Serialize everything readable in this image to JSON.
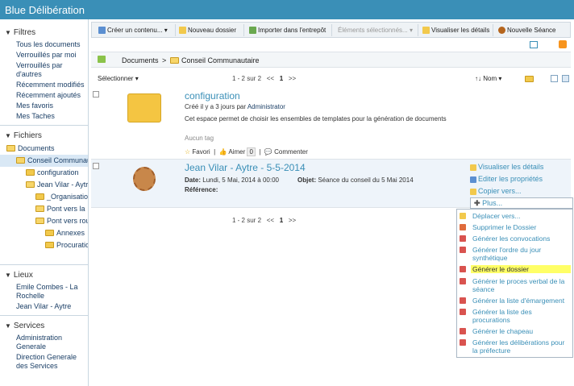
{
  "app": {
    "title": "Blue Délibération"
  },
  "sidebar": {
    "filters_title": "Filtres",
    "filters": [
      "Tous les documents",
      "Verrouillés par moi",
      "Verrouillés par d'autres",
      "Récemment modifiés",
      "Récemment ajoutés",
      "Mes favoris",
      "Mes Taches"
    ],
    "files_title": "Fichiers",
    "tree": [
      "Documents",
      "Conseil Communautaire",
      "configuration",
      "Jean Vilar - Aytre",
      "_Organisation",
      "Pont vers la",
      "Pont vers rou",
      "Annexes",
      "Procurations"
    ],
    "places_title": "Lieux",
    "places": [
      "Emile Combes - La Rochelle",
      "Jean Vilar - Aytre"
    ],
    "services_title": "Services",
    "services": [
      "Administration Generale",
      "Direction Generale des Services"
    ]
  },
  "toolbar": {
    "create": "Créer un contenu...",
    "new_folder": "Nouveau dossier",
    "import": "Importer dans l'entrepôt",
    "selected": "Éléments sélectionnés...",
    "view_details": "Visualiser les détails",
    "new_session": "Nouvelle Séance"
  },
  "path": {
    "root": "Documents",
    "separator": ">",
    "current": "Conseil Communautaire"
  },
  "list": {
    "select_label": "Sélectionner",
    "pagination": "1 - 2 sur 2",
    "prev": "<<",
    "page": "1",
    "next": ">>",
    "sort_label": "Nom"
  },
  "items": [
    {
      "title": "configuration",
      "created": "Créé il y a 3 jours par",
      "creator": "Administrator",
      "description": "Cet espace permet de choisir les ensembles de templates pour la génération de documents",
      "tags": "Aucun tag",
      "favorite": "Favori",
      "like": "Aimer",
      "like_count": "0",
      "comment": "Commenter"
    },
    {
      "title": "Jean Vilar - Aytre - 5-5-2014",
      "date_label": "Date:",
      "date_value": "Lundi, 5 Mai, 2014 à 00:00",
      "object_label": "Objet:",
      "object_value": "Séance du conseil du 5 Mai 2014",
      "reference_label": "Référence:"
    }
  ],
  "actions": [
    "Visualiser les détails",
    "Editer les propriétés",
    "Copier vers...",
    "Plus..."
  ],
  "more_menu": [
    "Déplacer vers...",
    "Supprimer le Dossier",
    "Générer les convocations",
    "Générer l'ordre du jour synthétique",
    "Générer le dossier",
    "Générer le proces verbal de la séance",
    "Générer la liste d'émargement",
    "Générer la liste des procurations",
    "Générer le chapeau",
    "Générer les délibérations pour la préfecture"
  ]
}
